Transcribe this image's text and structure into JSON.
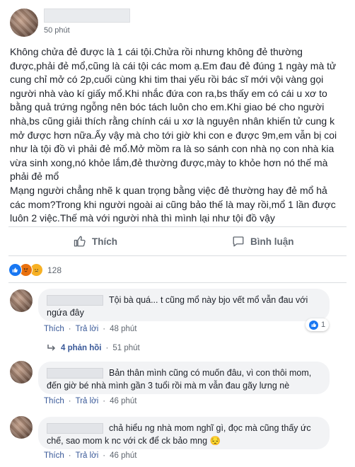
{
  "post": {
    "time": "50 phút",
    "body": "Không chửa đẻ được là 1 cái tội.Chửa rồi nhưng không đẻ thường được,phải đẻ mổ,cũng là cái tội các mom ạ.Em đau đẻ đúng 1 ngày mà tử cung chỉ mở có 2p,cuối cùng khi tim thai yếu rồi bác sĩ mới vội vàng gọi người nhà vào kí giấy mổ.Khi nhắc đứa con ra,bs thấy em có cái u xơ to bằng quả trứng ngỗng nên bóc tách luôn cho em.Khi giao bé cho người nhà,bs cũng giải thích rằng chính cái u xơ là nguyên nhân khiến tử cung k mở được hơn nữa.Ấy vậy mà cho tới giờ khi con e được 9m,em vẫn bị coi như là tội đồ vì phải đẻ mổ.Mở mồm ra là so sánh con nhà nọ con nhà kia vừa sinh xong,nó khỏe lắm,đẻ thường được,mày to khỏe hơn nó thế mà phải đẻ mổ\nMạng người chẳng nhẽ k quan trọng bằng việc đẻ thường hay đẻ mổ hả các mom?Trong khi người ngoài ai cũng bảo thế là may rồi,mổ 1 lần được luôn 2 việc.Thế mà với người nhà thì mình lại như tội đồ vậy"
  },
  "actions": {
    "like": "Thích",
    "comment": "Bình luận"
  },
  "reactions": {
    "count": "128"
  },
  "comments": [
    {
      "text": "Tội bà quá... t cũng mổ này bjo vết mổ vẫn đau với ngứa đây",
      "like": "Thích",
      "reply": "Trả lời",
      "time": "48 phút",
      "likes": "1"
    },
    {
      "text": "Bản thân mình cũng có muốn đâu, vì con thôi mom, đến giờ bé nhà mình gần 3 tuổi rồi mà m vẫn đau gãy lưng nè",
      "like": "Thích",
      "reply": "Trả lời",
      "time": "46 phút"
    },
    {
      "text": "chả hiểu ng nhà mom nghĩ gì, đọc mà cũng thấy ức chế, sao mom k nc với ck để ck bảo mng 😔",
      "like": "Thích",
      "reply": "Trả lời",
      "time": "46 phút"
    }
  ],
  "replies": {
    "count": "4 phản hồi",
    "time": "51 phút"
  }
}
